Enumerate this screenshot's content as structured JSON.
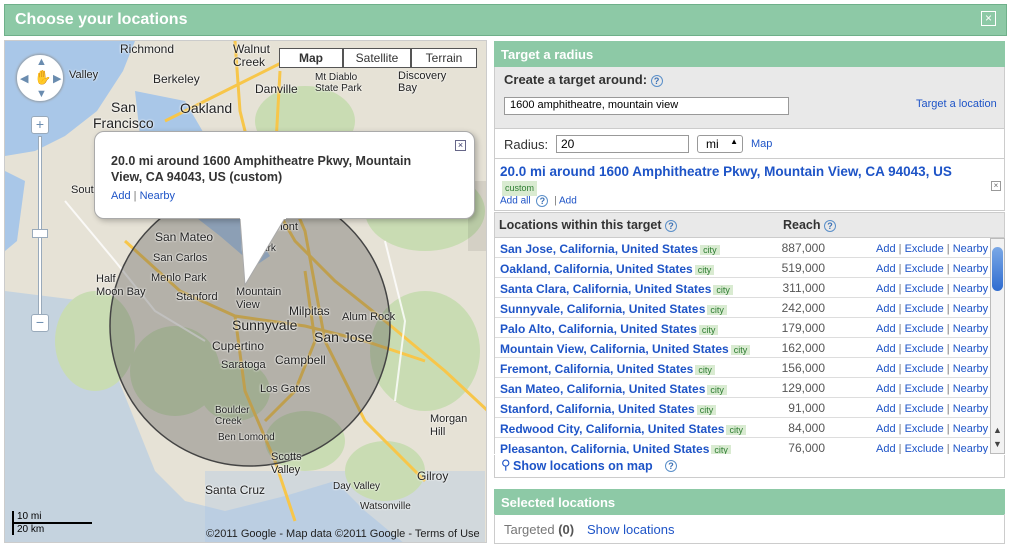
{
  "dialog": {
    "title": "Choose your locations",
    "close_icon": "×"
  },
  "map": {
    "map_types": [
      "Map",
      "Satellite",
      "Terrain"
    ],
    "selected_type": "Map",
    "places": [
      {
        "name": "Richmond",
        "big": false
      },
      {
        "name": "Walnut Creek",
        "big": false
      },
      {
        "name": "Mt Diablo State Park",
        "big": false
      },
      {
        "name": "Discovery Bay",
        "big": false
      },
      {
        "name": "Berkeley",
        "big": false
      },
      {
        "name": "San",
        "big": true
      },
      {
        "name": "Oakland",
        "big": true
      },
      {
        "name": "Danville",
        "big": false
      },
      {
        "name": "Francisco",
        "big": true
      },
      {
        "name": "San Mateo",
        "big": false
      },
      {
        "name": "San Carlos",
        "big": false
      },
      {
        "name": "Menlo Park",
        "big": false
      },
      {
        "name": "Stanford",
        "big": false
      },
      {
        "name": "Half Moon Bay",
        "big": false
      },
      {
        "name": "Milpitas",
        "big": false
      },
      {
        "name": "Sunnyvale",
        "big": true
      },
      {
        "name": "San Jose",
        "big": true
      },
      {
        "name": "Cupertino",
        "big": false
      },
      {
        "name": "Campbell",
        "big": false
      },
      {
        "name": "Saratoga",
        "big": false
      },
      {
        "name": "Los Gatos",
        "big": false
      },
      {
        "name": "Alum Rock",
        "big": false
      },
      {
        "name": "Boulder Creek",
        "big": false
      },
      {
        "name": "Ben Lomond",
        "big": false
      },
      {
        "name": "Scotts Valley",
        "big": false
      },
      {
        "name": "Morgan Hill",
        "big": false
      },
      {
        "name": "Gilroy",
        "big": false
      },
      {
        "name": "Santa Cruz",
        "big": false
      },
      {
        "name": "Day Valley",
        "big": false
      },
      {
        "name": "Watsonville",
        "big": false
      },
      {
        "name": "Mountain View",
        "big": false
      },
      {
        "name": "Fremont",
        "big": false
      },
      {
        "name": "Newark",
        "big": false
      },
      {
        "name": "Valley",
        "big": false
      },
      {
        "name": "South",
        "big": false
      }
    ],
    "bubble": {
      "text": "20.0 mi around 1600 Amphitheatre Pkwy, Mountain View, CA 94043, US (custom)",
      "add": "Add",
      "sep": "|",
      "nearby": "Nearby"
    },
    "scale": {
      "mi": "10 mi",
      "km": "20 km"
    },
    "copyright": "©2011 Google - Map data ©2011 Google - Terms of Use"
  },
  "radius_panel": {
    "header": "Target a radius",
    "create_label": "Create a target around:",
    "address_value": "1600 amphitheatre, mountain view",
    "target_location_link": "Target a location",
    "radius_label": "Radius:",
    "radius_value": "20",
    "unit_value": "mi",
    "map_link": "Map",
    "result_title": "20.0 mi around 1600 Amphitheatre Pkwy, Mountain View, CA 94043, US",
    "custom_badge": "custom",
    "add_all": "Add all",
    "add": "Add"
  },
  "locations": {
    "col_locations": "Locations within this target",
    "col_reach": "Reach",
    "badge": "city",
    "actions": {
      "add": "Add",
      "exclude": "Exclude",
      "nearby": "Nearby",
      "sep": "|"
    },
    "rows": [
      {
        "name": "San Jose, California, United States",
        "reach": "887,000"
      },
      {
        "name": "Oakland, California, United States",
        "reach": "519,000"
      },
      {
        "name": "Santa Clara, California, United States",
        "reach": "311,000"
      },
      {
        "name": "Sunnyvale, California, United States",
        "reach": "242,000"
      },
      {
        "name": "Palo Alto, California, United States",
        "reach": "179,000"
      },
      {
        "name": "Mountain View, California, United States",
        "reach": "162,000"
      },
      {
        "name": "Fremont, California, United States",
        "reach": "156,000"
      },
      {
        "name": "San Mateo, California, United States",
        "reach": "129,000"
      },
      {
        "name": "Stanford, California, United States",
        "reach": "91,000"
      },
      {
        "name": "Redwood City, California, United States",
        "reach": "84,000"
      },
      {
        "name": "Pleasanton, California, United States",
        "reach": "76,000"
      }
    ],
    "show_on_map": "Show locations on map"
  },
  "selected": {
    "header": "Selected locations",
    "targeted_label": "Targeted",
    "targeted_count": "(0)",
    "show_locations": "Show locations"
  },
  "colors": {
    "header_green": "#8dc9a6",
    "link_blue": "#1e54c7",
    "badge_green": "#d9ebd1"
  }
}
